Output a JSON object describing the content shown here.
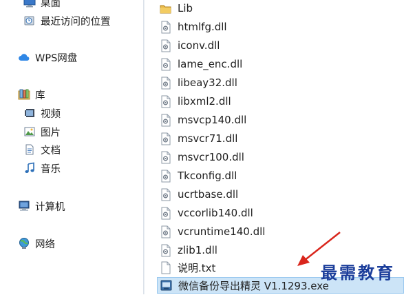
{
  "sidebar": {
    "items": [
      {
        "label": "桌面",
        "icon": "desktop-icon"
      },
      {
        "label": "最近访问的位置",
        "icon": "recent-places-icon"
      },
      {
        "label": "WPS网盘",
        "icon": "cloud-icon"
      },
      {
        "label": "库",
        "icon": "libraries-icon"
      },
      {
        "label": "视频",
        "icon": "video-library-icon"
      },
      {
        "label": "图片",
        "icon": "pictures-library-icon"
      },
      {
        "label": "文档",
        "icon": "documents-library-icon"
      },
      {
        "label": "音乐",
        "icon": "music-library-icon"
      },
      {
        "label": "计算机",
        "icon": "computer-icon"
      },
      {
        "label": "网络",
        "icon": "network-icon"
      }
    ]
  },
  "files": {
    "items": [
      {
        "name": "Lib",
        "icon": "folder-icon"
      },
      {
        "name": "htmlfg.dll",
        "icon": "dll-file-icon"
      },
      {
        "name": "iconv.dll",
        "icon": "dll-file-icon"
      },
      {
        "name": "lame_enc.dll",
        "icon": "dll-file-icon"
      },
      {
        "name": "libeay32.dll",
        "icon": "dll-file-icon"
      },
      {
        "name": "libxml2.dll",
        "icon": "dll-file-icon"
      },
      {
        "name": "msvcp140.dll",
        "icon": "dll-file-icon"
      },
      {
        "name": "msvcr71.dll",
        "icon": "dll-file-icon"
      },
      {
        "name": "msvcr100.dll",
        "icon": "dll-file-icon"
      },
      {
        "name": "Tkconfig.dll",
        "icon": "dll-file-icon"
      },
      {
        "name": "ucrtbase.dll",
        "icon": "dll-file-icon"
      },
      {
        "name": "vccorlib140.dll",
        "icon": "dll-file-icon"
      },
      {
        "name": "vcruntime140.dll",
        "icon": "dll-file-icon"
      },
      {
        "name": "zlib1.dll",
        "icon": "dll-file-icon"
      },
      {
        "name": "说明.txt",
        "icon": "text-file-icon"
      },
      {
        "name": "微信备份导出精灵 V1.1293.exe",
        "icon": "exe-file-icon",
        "selected": true
      }
    ]
  },
  "watermark": {
    "text": "最需教育"
  },
  "colors": {
    "selection": "#cce4f7",
    "selection_border": "#99c8ef",
    "arrow": "#d9261c",
    "watermark": "#1c3e9b"
  }
}
